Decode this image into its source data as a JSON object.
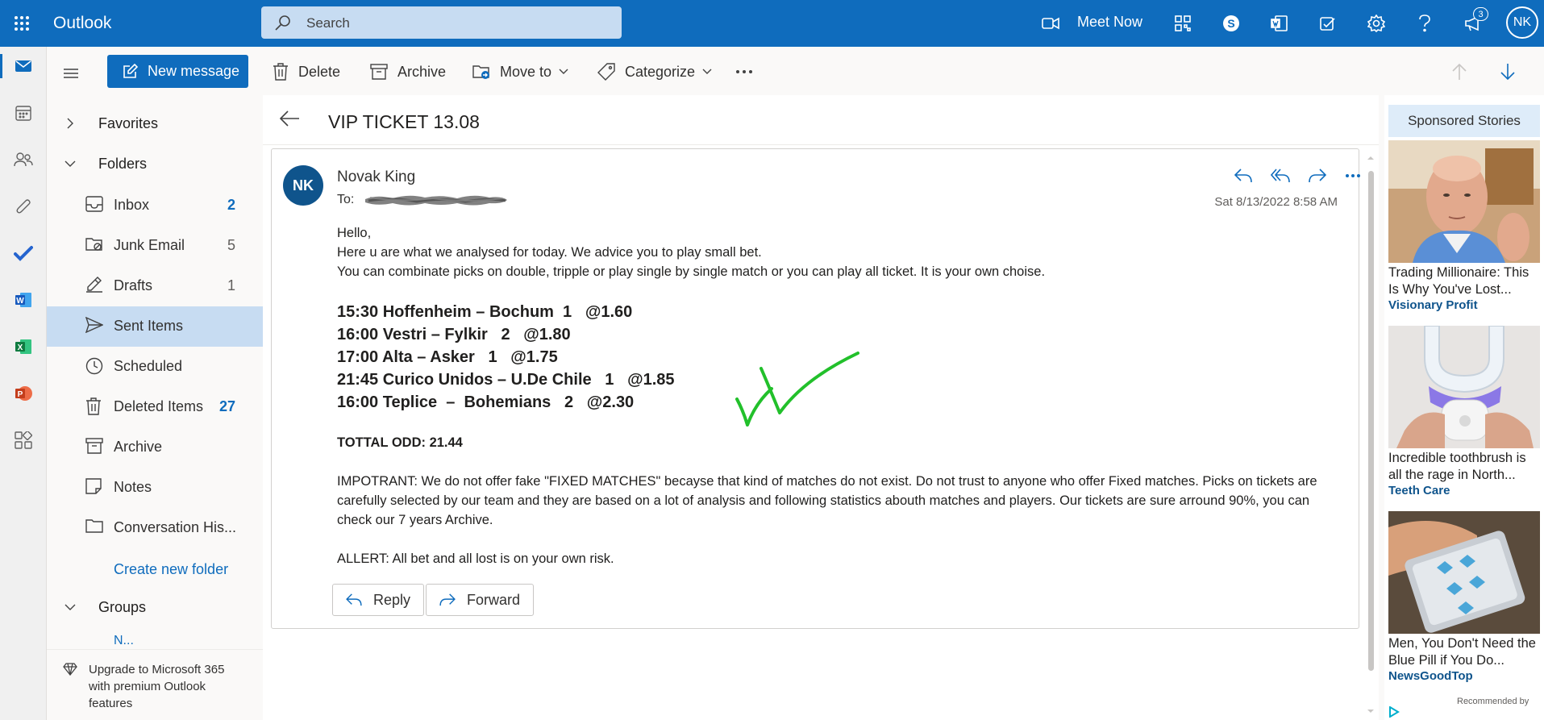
{
  "topbar": {
    "app_name": "Outlook",
    "search_placeholder": "Search",
    "meet_now": "Meet Now",
    "notifications_count": "3",
    "avatar_initials": "NK"
  },
  "toolbar": {
    "new_message": "New message",
    "delete": "Delete",
    "archive": "Archive",
    "move_to": "Move to",
    "categorize": "Categorize"
  },
  "folders": {
    "favorites": "Favorites",
    "folders": "Folders",
    "groups": "Groups",
    "groups_first_item": "N...",
    "create_new_folder": "Create new folder",
    "items": [
      {
        "label": "Inbox",
        "count": "2"
      },
      {
        "label": "Junk Email",
        "count": "5"
      },
      {
        "label": "Drafts",
        "count": "1"
      },
      {
        "label": "Sent Items",
        "count": ""
      },
      {
        "label": "Scheduled",
        "count": ""
      },
      {
        "label": "Deleted Items",
        "count": "27"
      },
      {
        "label": "Archive",
        "count": ""
      },
      {
        "label": "Notes",
        "count": ""
      },
      {
        "label": "Conversation His...",
        "count": ""
      }
    ],
    "upgrade": "Upgrade to Microsoft 365 with premium Outlook features"
  },
  "message": {
    "subject": "VIP TICKET 13.08",
    "sender_initials": "NK",
    "sender_name": "Novak King",
    "to_label": "To:",
    "date": "Sat 8/13/2022 8:58 AM",
    "greeting": "Hello,",
    "line1": "Here u are what we analysed for today. We advice you to play small bet.",
    "line2": "You can combinate picks on double, tripple or play single by single match or you can play all ticket. It is your own choise.",
    "picks": [
      "15:30 Hoffenheim – Bochum  1   @1.60",
      "16:00 Vestri – Fylkir   2   @1.80",
      "17:00 Alta – Asker   1   @1.75",
      "21:45 Curico Unidos – U.De Chile   1   @1.85",
      "16:00 Teplice  –  Bohemians   2   @2.30"
    ],
    "total": "TOTTAL ODD: 21.44",
    "important": "IMPOTRANT: We do not offer fake \"FIXED MATCHES\" becayse that kind of matches do not exist. Do not trust to anyone who offer Fixed matches. Picks on tickets are carefully selected by our team and they are based on a lot of analysis and following statistics abouth matches and players. Our tickets are sure arround 90%, you can check our 7 years Archive.",
    "allert": "ALLERT: All bet and all lost is on your own risk.",
    "reply": "Reply",
    "forward": "Forward"
  },
  "ads": {
    "header": "Sponsored Stories",
    "footer": "Recommended by",
    "items": [
      {
        "title": "Trading Millionaire: This Is Why You've Lost...",
        "source": "Visionary Profit"
      },
      {
        "title": "Incredible toothbrush is all the rage in North...",
        "source": "Teeth Care"
      },
      {
        "title": "Men, You Don't Need the Blue Pill if You Do...",
        "source": "NewsGoodTop"
      }
    ]
  },
  "colors": {
    "brand": "#0f6cbd",
    "selected": "#c7dcf2",
    "checkmark": "#22c02b"
  }
}
